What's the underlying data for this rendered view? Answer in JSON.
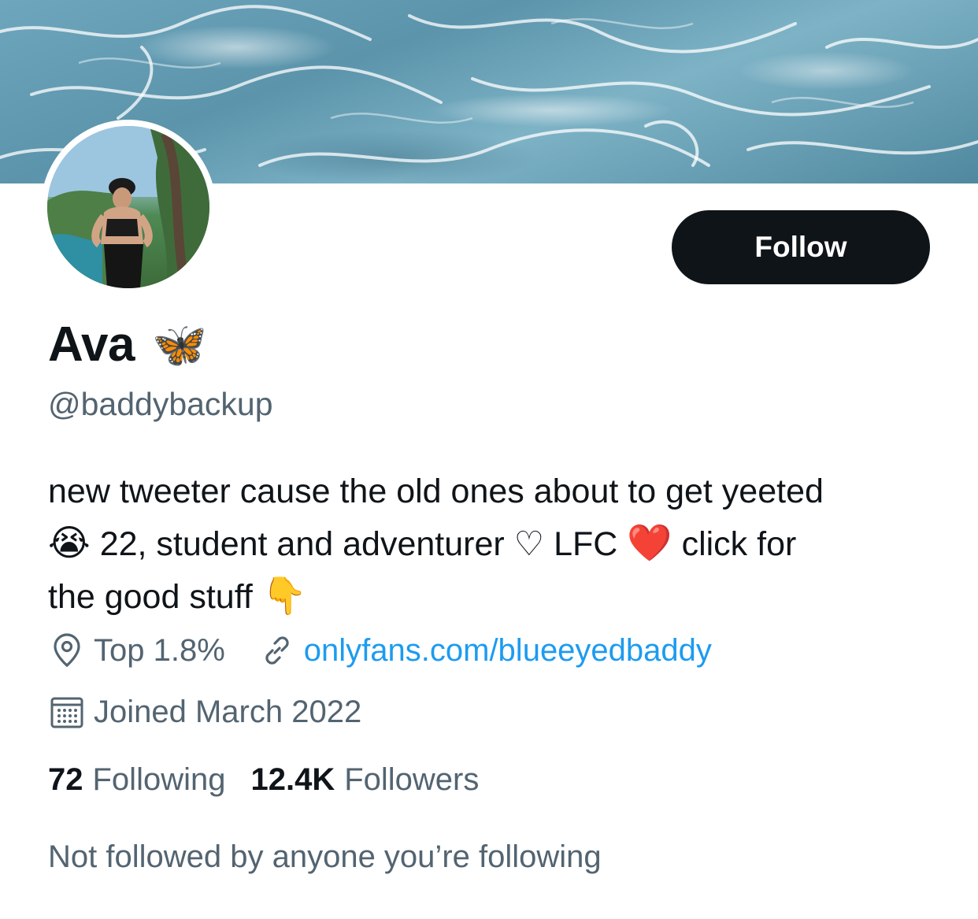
{
  "profile": {
    "name": "Ava",
    "name_emoji": "🦋",
    "handle": "@baddybackup",
    "follow_label": "Follow",
    "bio_line1": "new tweeter cause the old ones about to get yeeted",
    "bio_line2_emoji1": "😭",
    "bio_line2_text1": "22, student and adventurer ♡ LFC",
    "bio_line2_emoji2": "❤️",
    "bio_line2_text2": "click for",
    "bio_line3_text": "the good stuff",
    "bio_line3_emoji": "👇",
    "location": "Top 1.8%",
    "website": "onlyfans.com/blueeyedbaddy",
    "joined": "Joined March 2022",
    "following_count": "72",
    "following_label": "Following",
    "followers_count": "12.4K",
    "followers_label": "Followers",
    "mutuals_note": "Not followed by anyone you’re following"
  },
  "icons": {
    "location": "location-pin-icon",
    "link": "link-icon",
    "calendar": "calendar-icon"
  },
  "colors": {
    "text_primary": "#0f1419",
    "text_secondary": "#536471",
    "link": "#1d9bf0",
    "button_bg": "#0f1419",
    "button_text": "#ffffff"
  }
}
